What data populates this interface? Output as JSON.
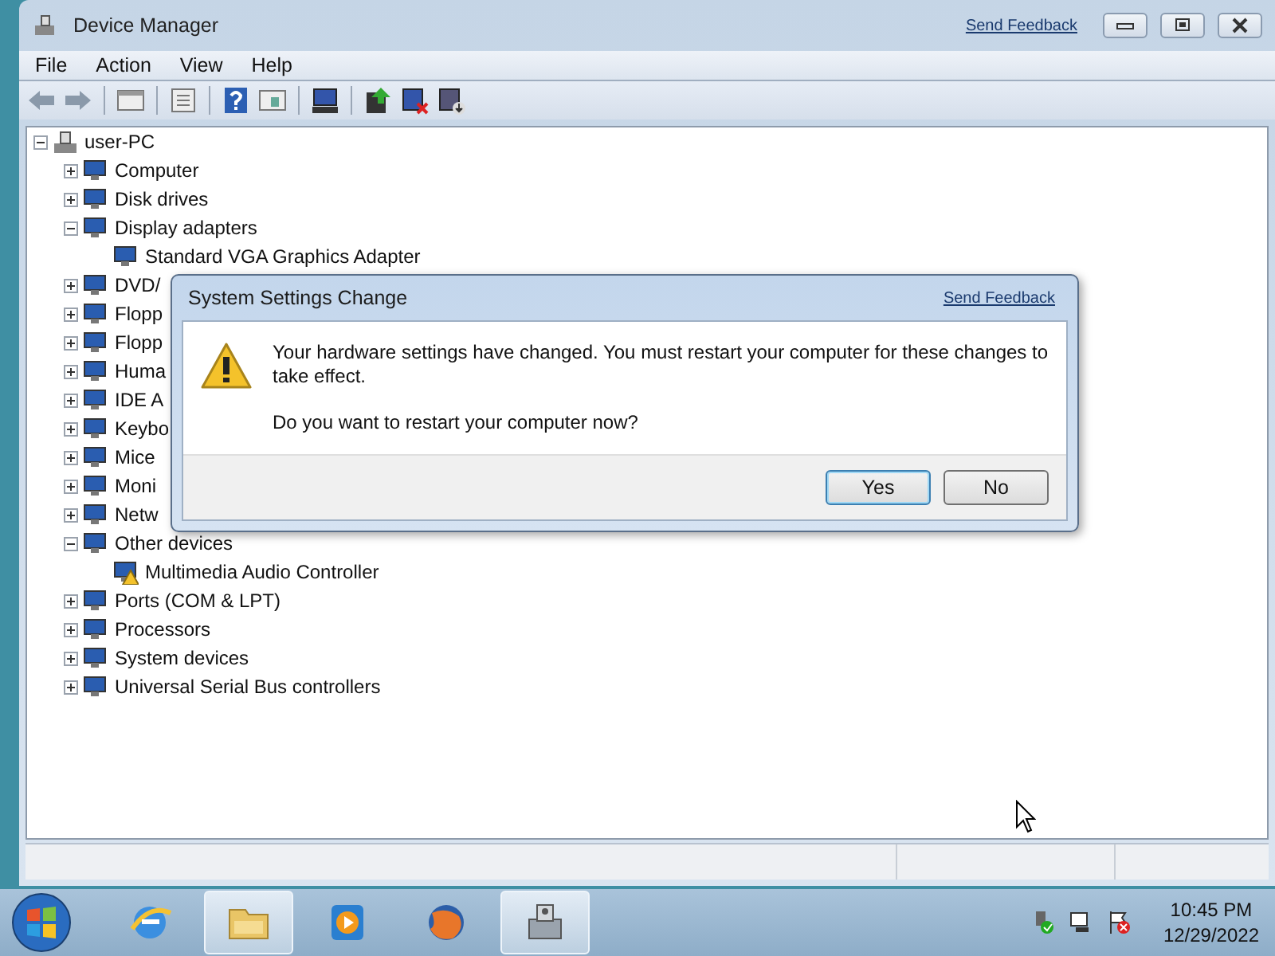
{
  "window": {
    "title": "Device Manager",
    "feedback_link": "Send Feedback"
  },
  "menu": [
    "File",
    "Action",
    "View",
    "Help"
  ],
  "tree": {
    "label": "user-PC",
    "expanded": true,
    "children": [
      {
        "label": "Computer",
        "expanded": false
      },
      {
        "label": "Disk drives",
        "expanded": false
      },
      {
        "label": "Display adapters",
        "expanded": true,
        "children": [
          {
            "label": "Standard VGA Graphics Adapter",
            "problem": false
          }
        ]
      },
      {
        "label": "DVD/",
        "expanded": false
      },
      {
        "label": "Flopp",
        "expanded": false
      },
      {
        "label": "Flopp",
        "expanded": false
      },
      {
        "label": "Huma",
        "expanded": false
      },
      {
        "label": "IDE A",
        "expanded": false
      },
      {
        "label": "Keybo",
        "expanded": false
      },
      {
        "label": "Mice",
        "expanded": false
      },
      {
        "label": "Moni",
        "expanded": false
      },
      {
        "label": "Netw",
        "expanded": false
      },
      {
        "label": "Other devices",
        "expanded": true,
        "children": [
          {
            "label": "Multimedia Audio Controller",
            "problem": true
          }
        ]
      },
      {
        "label": "Ports (COM & LPT)",
        "expanded": false
      },
      {
        "label": "Processors",
        "expanded": false
      },
      {
        "label": "System devices",
        "expanded": false
      },
      {
        "label": "Universal Serial Bus controllers",
        "expanded": false
      }
    ]
  },
  "dialog": {
    "title": "System Settings Change",
    "feedback_link": "Send Feedback",
    "message": "Your hardware settings have changed. You must restart your computer for these changes to take effect.",
    "question": "Do you want to restart your computer now?",
    "buttons": [
      {
        "label": "Yes",
        "selected": true
      },
      {
        "label": "No",
        "selected": false
      }
    ]
  },
  "taskbar": {
    "apps": [
      {
        "kind": "browser",
        "selected": false
      },
      {
        "kind": "folder",
        "selected": true
      },
      {
        "kind": "player",
        "selected": false
      },
      {
        "kind": "globe",
        "selected": false
      },
      {
        "kind": "devices",
        "selected": true
      }
    ],
    "time": "10:45 PM",
    "date": "12/29/2022"
  }
}
